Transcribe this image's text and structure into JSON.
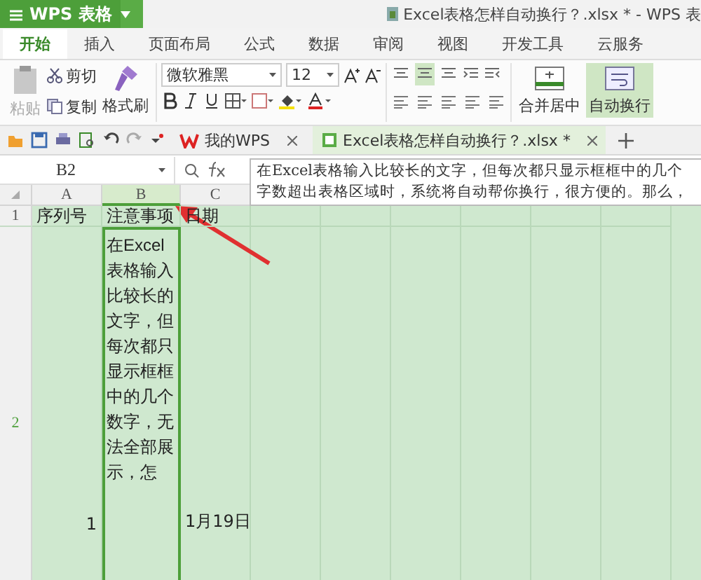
{
  "title_bar": {
    "app_button": "WPS 表格",
    "doc_title": "Excel表格怎样自动换行？.xlsx * - WPS 表"
  },
  "menu_tabs": [
    {
      "label": "开始",
      "selected": true
    },
    {
      "label": "插入",
      "selected": false
    },
    {
      "label": "页面布局",
      "selected": false
    },
    {
      "label": "公式",
      "selected": false
    },
    {
      "label": "数据",
      "selected": false
    },
    {
      "label": "审阅",
      "selected": false
    },
    {
      "label": "视图",
      "selected": false
    },
    {
      "label": "开发工具",
      "selected": false
    },
    {
      "label": "云服务",
      "selected": false
    }
  ],
  "ribbon": {
    "paste": {
      "label": "粘贴",
      "disabled": true
    },
    "cut": "剪切",
    "copy": "复制",
    "format_painter": "格式刷",
    "font_name": "微软雅黑",
    "font_size": "12",
    "merge": {
      "label": "合并居中",
      "selected": false
    },
    "wrap": {
      "label": "自动换行",
      "selected": true
    }
  },
  "doc_tabs": [
    {
      "label": "我的WPS",
      "selected": false
    },
    {
      "label": "Excel表格怎样自动换行？.xlsx *",
      "selected": true
    }
  ],
  "name_box": "B2",
  "formula_lines": [
    "在Excel表格输入比较长的文字，但每次都只显示框框中的几个",
    "字数超出表格区域时，系统将自动帮你换行，很方便的。那么，"
  ],
  "columns": [
    {
      "label": "A",
      "selected": false
    },
    {
      "label": "B",
      "selected": true
    },
    {
      "label": "C",
      "selected": false
    }
  ],
  "rows": [
    {
      "number": "1",
      "selected": false,
      "cells": [
        {
          "text": "序列号",
          "selected": false
        },
        {
          "text": "注意事项",
          "selected": false
        },
        {
          "text": "日期",
          "selected": false
        }
      ]
    },
    {
      "number": "2",
      "selected": true,
      "cells": [
        {
          "text": "1",
          "selected": false
        },
        {
          "text": "在Excel表格输入比较长的文字，但每次都只显示框框中的几个数字，无法全部展示，怎",
          "selected": true,
          "wrap": true
        },
        {
          "text": "1月19日",
          "selected": false
        }
      ]
    }
  ]
}
